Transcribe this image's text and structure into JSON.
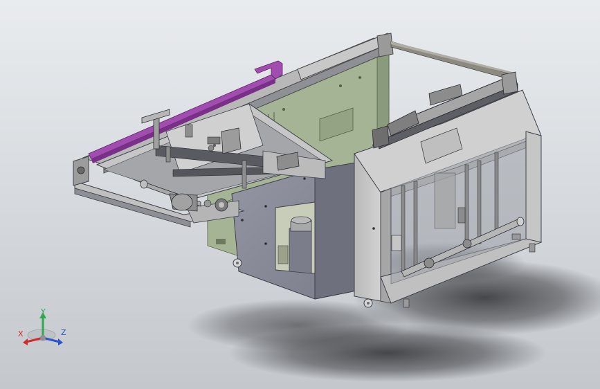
{
  "viewport": {
    "background_top": "#e9ecef",
    "background_bottom": "#c4c8cd"
  },
  "model": {
    "colors": {
      "frame_light": "#c9c9c9",
      "frame_mid": "#a7a7a7",
      "frame_dark": "#7d7f84",
      "panel_green": "#a4b494",
      "panel_green_dark": "#8a9a7c",
      "cabinet_slate": "#8a8d99",
      "cabinet_slate_dark": "#6e717d",
      "rail_purple": "#a14db0",
      "rail_purple_dark": "#7a2f88",
      "belt_gray": "#8c8a80",
      "shadow": "#3d3e42"
    }
  },
  "triad": {
    "x_label": "X",
    "y_label": "Y",
    "z_label": "Z",
    "x_color": "#d22b2b",
    "y_color": "#2fa84f",
    "z_color": "#2a55c9"
  }
}
